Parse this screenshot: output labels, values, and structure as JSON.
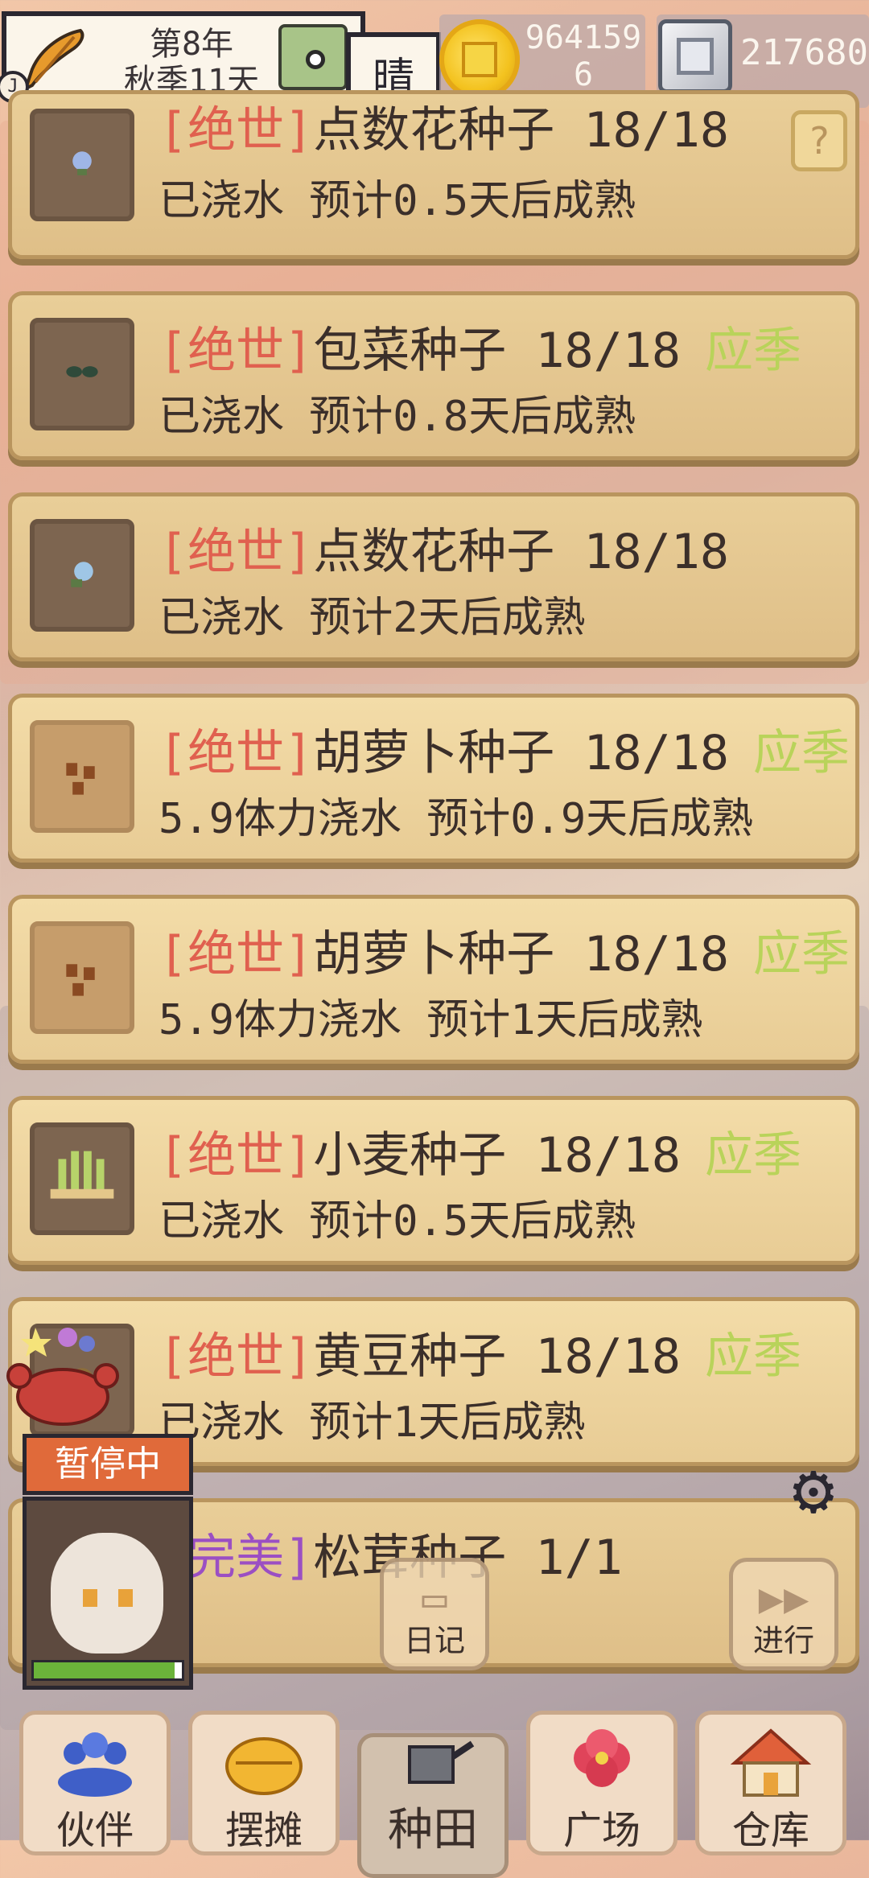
{
  "header": {
    "year": "第8年",
    "season_day": "秋季11天",
    "weather": "晴",
    "coins": "9641596",
    "gems": "217680"
  },
  "crops": [
    {
      "tier": "[绝世]",
      "name": "点数花种子",
      "count": "18/18",
      "season": "",
      "status": "已浇水 预计0.5天后成熟",
      "seed_icon": "blue-flower-sprout-icon"
    },
    {
      "tier": "[绝世]",
      "name": "包菜种子",
      "count": "18/18",
      "season": "应季",
      "status": "已浇水 预计0.8天后成熟",
      "seed_icon": "cabbage-seed-icon"
    },
    {
      "tier": "[绝世]",
      "name": "点数花种子",
      "count": "18/18",
      "season": "",
      "status": "已浇水 预计2天后成熟",
      "seed_icon": "blue-flower-sprout-icon"
    },
    {
      "tier": "[绝世]",
      "name": "胡萝卜种子",
      "count": "18/18",
      "season": "应季",
      "status": "5.9体力浇水 预计0.9天后成熟",
      "seed_icon": "carrot-seed-icon"
    },
    {
      "tier": "[绝世]",
      "name": "胡萝卜种子",
      "count": "18/18",
      "season": "应季",
      "status": "5.9体力浇水 预计1天后成熟",
      "seed_icon": "carrot-seed-icon"
    },
    {
      "tier": "[绝世]",
      "name": "小麦种子",
      "count": "18/18",
      "season": "应季",
      "status": "已浇水 预计0.5天后成熟",
      "seed_icon": "wheat-icon"
    },
    {
      "tier": "[绝世]",
      "name": "黄豆种子",
      "count": "18/18",
      "season": "应季",
      "status": "已浇水 预计1天后成熟",
      "seed_icon": "soybean-icon"
    },
    {
      "tier": "[完美]",
      "name": "松茸种子",
      "count": "1/1",
      "season": "",
      "status": "",
      "seed_icon": "mushroom-icon"
    }
  ],
  "help_label": "?",
  "character": {
    "status": "暂停中",
    "stamina_fraction": 0.95
  },
  "buttons": {
    "diary": "日记",
    "proceed": "进行"
  },
  "tabs": [
    {
      "label": "伙伴",
      "icon": "partners-icon"
    },
    {
      "label": "摆摊",
      "icon": "stall-icon"
    },
    {
      "label": "种田",
      "icon": "watering-can-icon"
    },
    {
      "label": "广场",
      "icon": "flower-icon"
    },
    {
      "label": "仓库",
      "icon": "house-icon"
    }
  ]
}
